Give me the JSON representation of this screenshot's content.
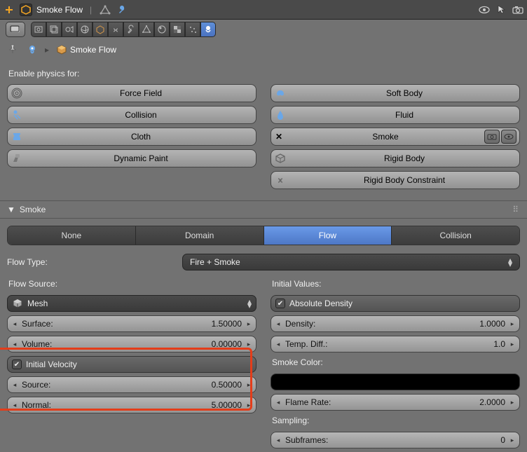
{
  "topbar": {
    "object_name": "Smoke Flow"
  },
  "breadcrumb": {
    "object": "Smoke Flow"
  },
  "enable_physics": {
    "label": "Enable physics for:",
    "left": [
      {
        "label": "Force Field"
      },
      {
        "label": "Collision"
      },
      {
        "label": "Cloth"
      },
      {
        "label": "Dynamic Paint"
      }
    ],
    "right": [
      {
        "label": "Soft Body"
      },
      {
        "label": "Fluid"
      },
      {
        "label": "Smoke"
      },
      {
        "label": "Rigid Body"
      },
      {
        "label": "Rigid Body Constraint"
      }
    ]
  },
  "smoke": {
    "panel_title": "Smoke",
    "tabs": {
      "none": "None",
      "domain": "Domain",
      "flow": "Flow",
      "collision": "Collision"
    },
    "flow_type_label": "Flow Type:",
    "flow_type_value": "Fire + Smoke",
    "flow_source_label": "Flow Source:",
    "flow_source_value": "Mesh",
    "surface": {
      "label": "Surface:",
      "value": "1.50000"
    },
    "volume": {
      "label": "Volume:",
      "value": "0.00000"
    },
    "initial_velocity_label": "Initial Velocity",
    "iv_source": {
      "label": "Source:",
      "value": "0.50000"
    },
    "iv_normal": {
      "label": "Normal:",
      "value": "5.00000"
    },
    "initial_values_label": "Initial Values:",
    "absolute_density_label": "Absolute Density",
    "density": {
      "label": "Density:",
      "value": "1.0000"
    },
    "temp_diff": {
      "label": "Temp. Diff.:",
      "value": "1.0"
    },
    "smoke_color_label": "Smoke Color:",
    "flame_rate": {
      "label": "Flame Rate:",
      "value": "2.0000"
    },
    "sampling_label": "Sampling:",
    "subframes": {
      "label": "Subframes:",
      "value": "0"
    }
  }
}
